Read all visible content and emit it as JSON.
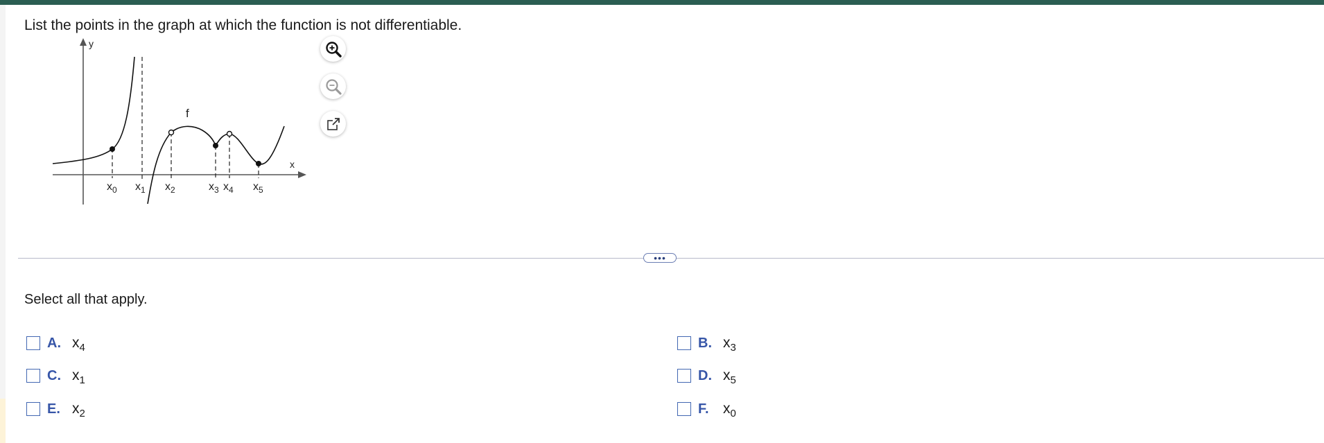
{
  "question": {
    "text": "List the points in the graph at which the function is not differentiable."
  },
  "graph": {
    "y_label": "y",
    "x_label": "x",
    "function_label": "f",
    "tick_labels": [
      {
        "base": "x",
        "sub": "0"
      },
      {
        "base": "x",
        "sub": "1"
      },
      {
        "base": "x",
        "sub": "2"
      },
      {
        "base": "x",
        "sub": "3"
      },
      {
        "base": "x",
        "sub": "4"
      },
      {
        "base": "x",
        "sub": "5"
      }
    ]
  },
  "tools": {
    "zoom_in_icon": "zoom-in-icon",
    "zoom_out_icon": "zoom-out-icon",
    "popout_icon": "external-link-icon"
  },
  "divider": {
    "more_label": "•••"
  },
  "instruction": {
    "text": "Select all that apply."
  },
  "options": [
    {
      "letter": "A.",
      "base": "x",
      "sub": "4",
      "checked": false
    },
    {
      "letter": "B.",
      "base": "x",
      "sub": "3",
      "checked": false
    },
    {
      "letter": "C.",
      "base": "x",
      "sub": "1",
      "checked": false
    },
    {
      "letter": "D.",
      "base": "x",
      "sub": "5",
      "checked": false
    },
    {
      "letter": "E.",
      "base": "x",
      "sub": "2",
      "checked": false
    },
    {
      "letter": "F.",
      "base": "x",
      "sub": "0",
      "checked": false
    }
  ],
  "colors": {
    "top_bar": "#2b5e52",
    "option_letter": "#3756a8",
    "checkbox_border": "#4267b2"
  }
}
